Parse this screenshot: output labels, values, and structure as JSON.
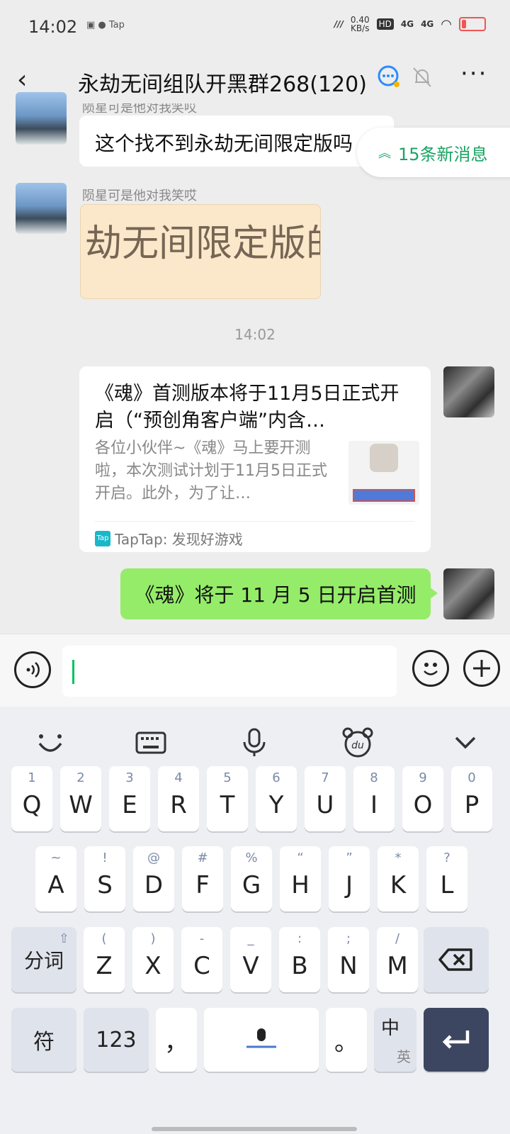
{
  "status_bar": {
    "time": "14:02",
    "app_indicator": "Tap",
    "net_speed": "0.40",
    "net_unit": "KB/s",
    "hd": "HD",
    "net1": "4G",
    "net2": "4G"
  },
  "header": {
    "back_icon": "chevron-left",
    "title": "永劫无间组队开黑群268(120)",
    "chat_icon": "chat-bubble",
    "bell_icon": "muted-bell",
    "more_label": "···"
  },
  "new_messages": {
    "label": "15条新消息",
    "icon": "double-chevron-up"
  },
  "messages": {
    "m1": {
      "sender": "陨星可是他对我笑哎",
      "text": "这个找不到永劫无间限定版吗"
    },
    "m2": {
      "sender": "陨星可是他对我笑哎",
      "image_text": "劫无间限定版的"
    },
    "timestamp": "14:02",
    "card": {
      "title": "《魂》首测版本将于11月5日正式开启（“预创角客户端”内含…",
      "desc": "各位小伙伴~《魂》马上要开测啦，本次测试计划于11月5日正式开启。此外，为了让…",
      "source_badge": "Tap",
      "source": "TapTap: 发现好游戏"
    },
    "m4": {
      "text": "《魂》将于 11 月 5 日开启首测"
    }
  },
  "input_bar": {
    "voice_icon": "voice-wave",
    "text_value": "",
    "emoji_icon": "smiley",
    "plus_icon": "plus-circle"
  },
  "keyboard": {
    "toolbar": [
      "smile-tool",
      "keyboard-tool",
      "mic-tool",
      "du-bear-tool",
      "collapse-chevron"
    ],
    "row1": [
      {
        "k": "Q",
        "n": "1"
      },
      {
        "k": "W",
        "n": "2"
      },
      {
        "k": "E",
        "n": "3"
      },
      {
        "k": "R",
        "n": "4"
      },
      {
        "k": "T",
        "n": "5"
      },
      {
        "k": "Y",
        "n": "6"
      },
      {
        "k": "U",
        "n": "7"
      },
      {
        "k": "I",
        "n": "8"
      },
      {
        "k": "O",
        "n": "9"
      },
      {
        "k": "P",
        "n": "0"
      }
    ],
    "row2": [
      {
        "k": "A",
        "n": "~"
      },
      {
        "k": "S",
        "n": "!"
      },
      {
        "k": "D",
        "n": "@"
      },
      {
        "k": "F",
        "n": "#"
      },
      {
        "k": "G",
        "n": "%"
      },
      {
        "k": "H",
        "n": "“"
      },
      {
        "k": "J",
        "n": "”"
      },
      {
        "k": "K",
        "n": "*"
      },
      {
        "k": "L",
        "n": "?"
      }
    ],
    "row3": [
      {
        "k": "Z",
        "n": "("
      },
      {
        "k": "X",
        "n": ")"
      },
      {
        "k": "C",
        "n": "-"
      },
      {
        "k": "V",
        "n": "_"
      },
      {
        "k": "B",
        "n": ":"
      },
      {
        "k": "N",
        "n": ";"
      },
      {
        "k": "M",
        "n": "/"
      }
    ],
    "shift_label": "分词",
    "symbol_label": "符",
    "num_label": "123",
    "comma": "，",
    "period": "。",
    "lang_top": "中",
    "lang_bottom": "英"
  }
}
